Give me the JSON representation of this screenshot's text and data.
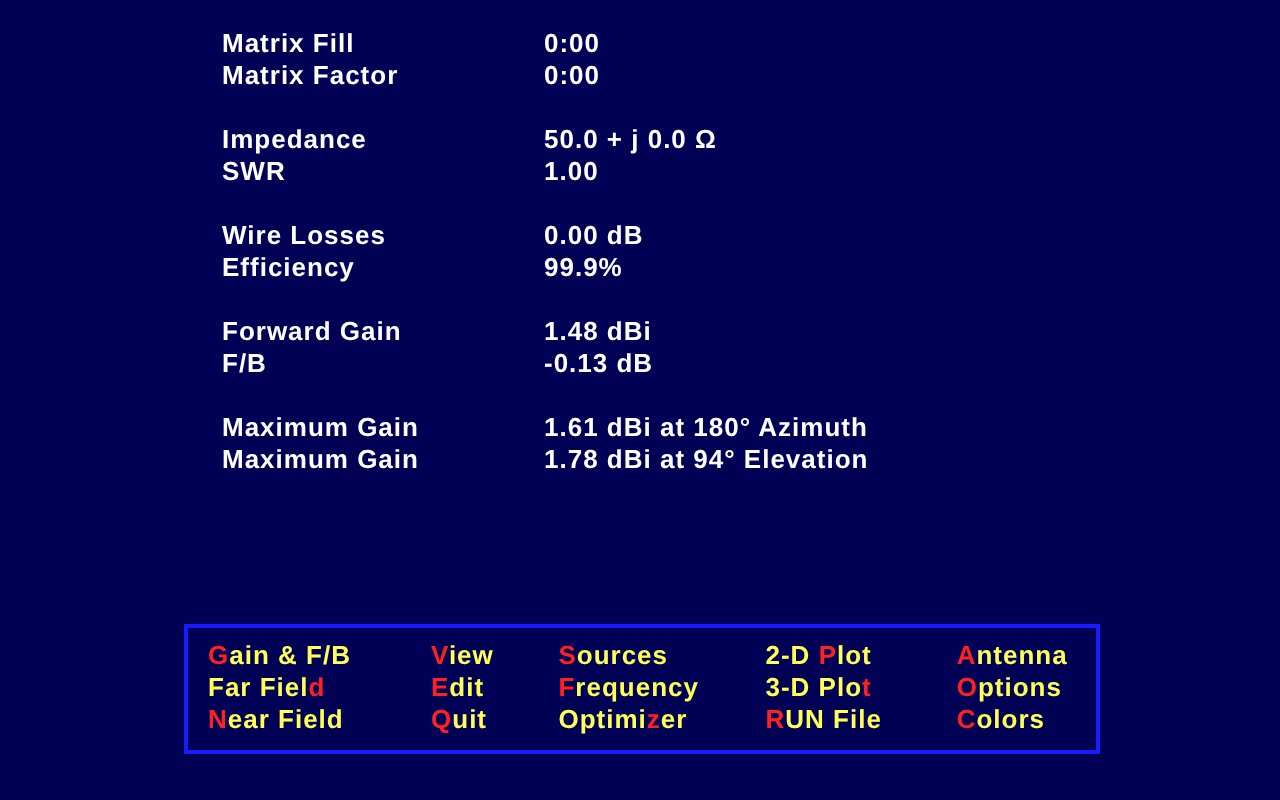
{
  "results": [
    [
      {
        "label": "Matrix Fill",
        "value": "0:00"
      },
      {
        "label": "Matrix Factor",
        "value": "0:00"
      }
    ],
    [
      {
        "label": "Impedance",
        "value": "50.0 + j 0.0 Ω"
      },
      {
        "label": "SWR",
        "value": "1.00"
      }
    ],
    [
      {
        "label": "Wire Losses",
        "value": "0.00 dB"
      },
      {
        "label": "Efficiency",
        "value": "99.9%"
      }
    ],
    [
      {
        "label": "Forward Gain",
        "value": "1.48 dBi"
      },
      {
        "label": "F/B",
        "value": "-0.13 dB"
      }
    ],
    [
      {
        "label": "Maximum Gain",
        "value": "1.61 dBi at 180° Azimuth"
      },
      {
        "label": "Maximum Gain",
        "value": "1.78 dBi at 94° Elevation"
      }
    ]
  ],
  "menu": {
    "columns": [
      [
        {
          "key": "G",
          "after": "ain & F/B"
        },
        {
          "before": "Far Fiel",
          "key": "d"
        },
        {
          "key": "N",
          "after": "ear Field"
        }
      ],
      [
        {
          "key": "V",
          "after": "iew"
        },
        {
          "key": "E",
          "after": "dit"
        },
        {
          "key": "Q",
          "after": "uit"
        }
      ],
      [
        {
          "key": "S",
          "after": "ources"
        },
        {
          "key": "F",
          "after": "requency"
        },
        {
          "before": "Optimi",
          "key": "z",
          "after": "er"
        }
      ],
      [
        {
          "before": "2-D ",
          "key": "P",
          "after": "lot"
        },
        {
          "before": "3-D Plo",
          "key": "t"
        },
        {
          "key": "R",
          "after": "UN File"
        }
      ],
      [
        {
          "key": "A",
          "after": "ntenna"
        },
        {
          "key": "O",
          "after": "ptions"
        },
        {
          "key": "C",
          "after": "olors"
        }
      ]
    ]
  }
}
